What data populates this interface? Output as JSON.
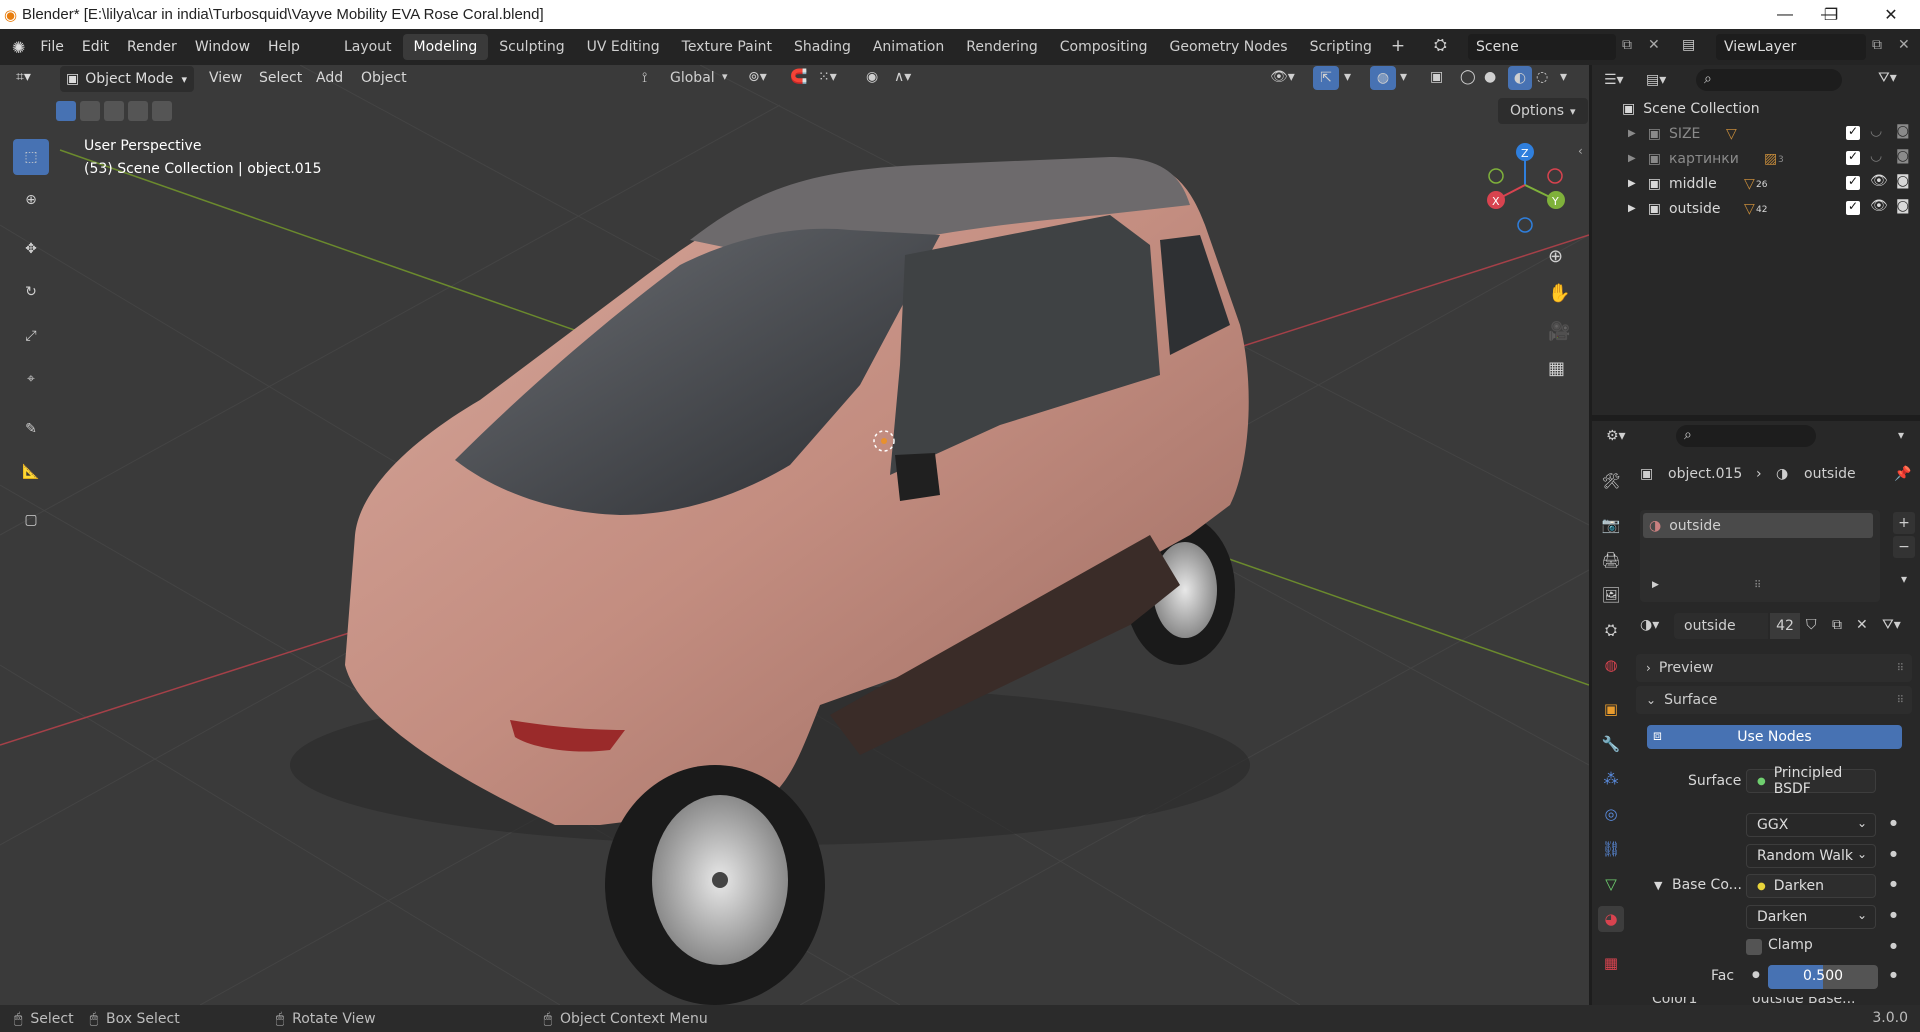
{
  "titlebar": {
    "title": "Blender* [E:\\lilya\\car in india\\Turbosquid\\Vayve Mobility EVA Rose Coral.blend]",
    "minimize": "—",
    "maximize": "❐",
    "close": "✕"
  },
  "menu": {
    "file": "File",
    "edit": "Edit",
    "render": "Render",
    "window": "Window",
    "help": "Help"
  },
  "workspaces": [
    "Layout",
    "Modeling",
    "Sculpting",
    "UV Editing",
    "Texture Paint",
    "Shading",
    "Animation",
    "Rendering",
    "Compositing",
    "Geometry Nodes",
    "Scripting"
  ],
  "workspace_add": "+",
  "scene": {
    "name": "Scene"
  },
  "viewlayer": {
    "name": "ViewLayer"
  },
  "viewport_header": {
    "mode": "Object Mode",
    "view": "View",
    "select": "Select",
    "add": "Add",
    "object": "Object",
    "transform": "Global",
    "options": "Options"
  },
  "viewport": {
    "perspective": "User Perspective",
    "context": "(53) Scene Collection | object.015",
    "gizmo": {
      "x": "X",
      "y": "Y",
      "z": "Z"
    }
  },
  "outliner": {
    "root": "Scene Collection",
    "items": [
      {
        "name": "SIZE",
        "count": ""
      },
      {
        "name": "картинки",
        "count": "3"
      },
      {
        "name": "middle",
        "count": "26"
      },
      {
        "name": "outside",
        "count": "42"
      }
    ]
  },
  "properties": {
    "breadcrumb_object": "object.015",
    "breadcrumb_material": "outside",
    "slot_name": "outside",
    "material_name": "outside",
    "users": "42",
    "preview": "Preview",
    "surface_panel": "Surface",
    "use_nodes": "Use Nodes",
    "surface_label": "Surface",
    "surface_value": "Principled BSDF",
    "distribution": "GGX",
    "subsurface": "Random Walk",
    "base_color_label": "Base Co...",
    "base_color_value": "Darken",
    "blend_mode": "Darken",
    "clamp": "Clamp",
    "fac_label": "Fac",
    "fac_value": "0.500",
    "fac_fraction": 0.5,
    "color1_label": "Color1",
    "color1_value": "outside Base..."
  },
  "statusbar": {
    "select": "Select",
    "box_select": "Box Select",
    "rotate": "Rotate View",
    "context_menu": "Object Context Menu",
    "version": "3.0.0"
  },
  "colors": {
    "accent": "#4772b3",
    "car_body": "#c59085",
    "viewport_bg": "#3a3a3a",
    "panel_bg": "#282828",
    "x_axis": "#d8434f",
    "y_axis": "#7fb13b",
    "z_axis": "#2f7fdd"
  }
}
